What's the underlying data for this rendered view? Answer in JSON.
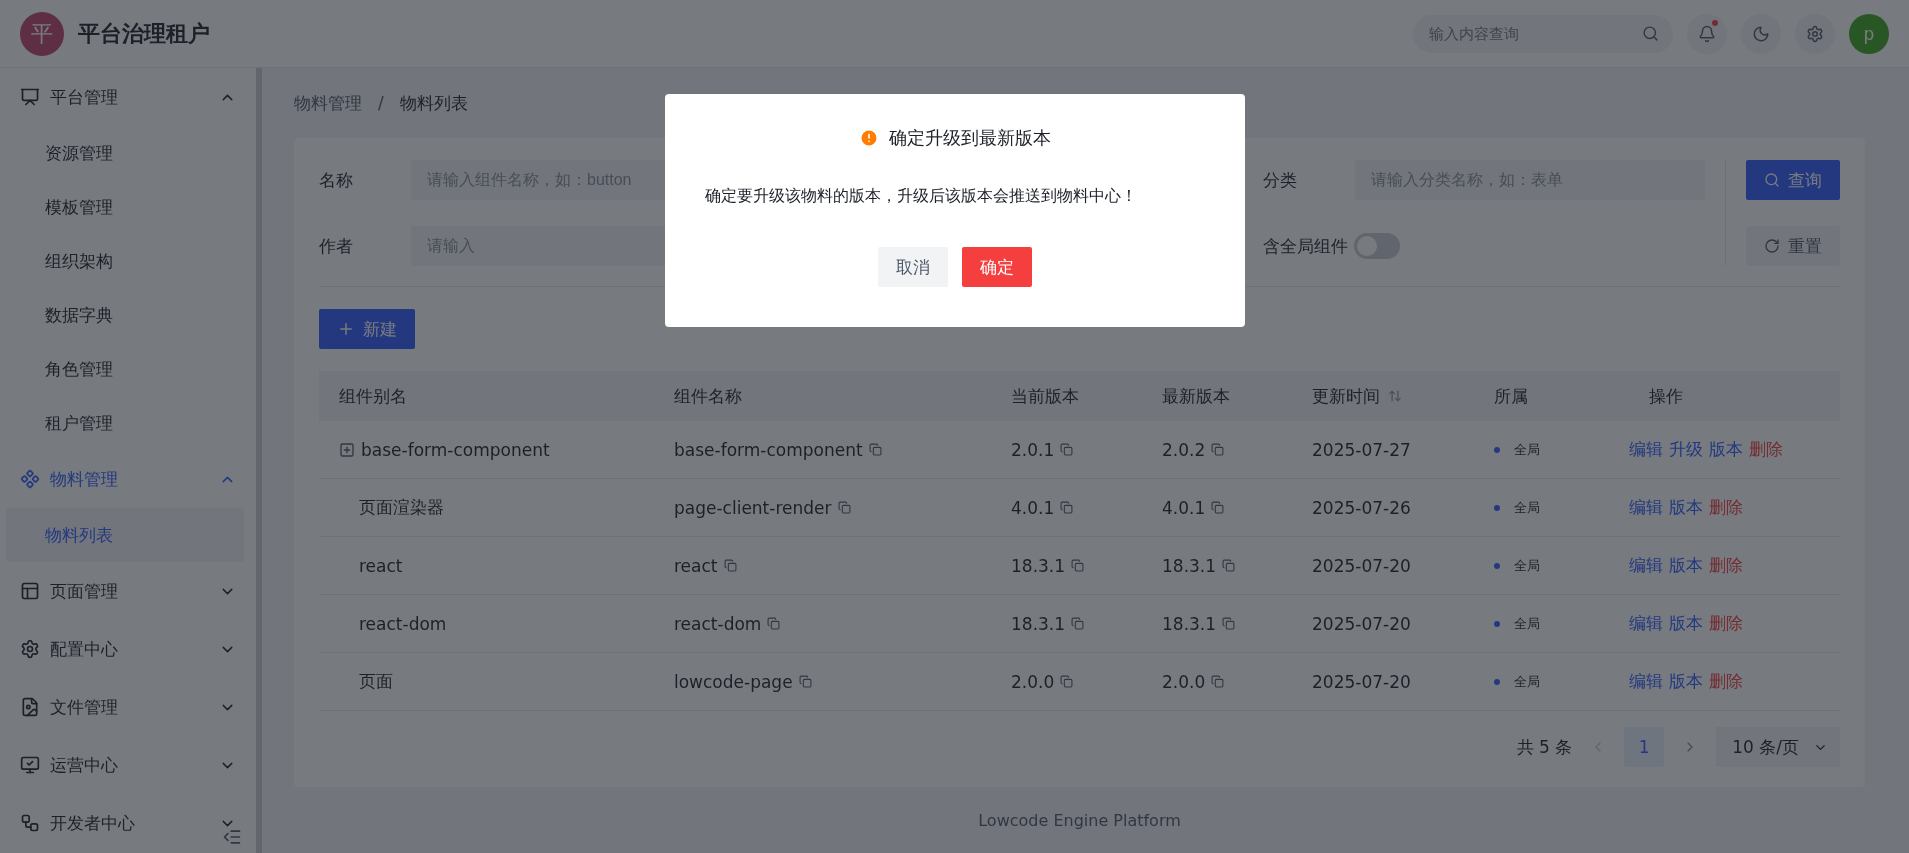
{
  "header": {
    "logo_letter": "平",
    "title": "平台治理租户",
    "search": {
      "placeholder": "输入内容查询"
    },
    "notification_dot": true,
    "avatar_letter": "p"
  },
  "sidebar": {
    "items": [
      {
        "label": "平台管理",
        "expanded": true,
        "selected": false,
        "children": [
          {
            "label": "资源管理",
            "selected": false
          },
          {
            "label": "模板管理",
            "selected": false
          },
          {
            "label": "组织架构",
            "selected": false
          },
          {
            "label": "数据字典",
            "selected": false
          },
          {
            "label": "角色管理",
            "selected": false
          },
          {
            "label": "租户管理",
            "selected": false
          }
        ]
      },
      {
        "label": "物料管理",
        "expanded": true,
        "selected": true,
        "children": [
          {
            "label": "物料列表",
            "selected": true
          }
        ]
      },
      {
        "label": "页面管理",
        "expanded": false,
        "selected": false
      },
      {
        "label": "配置中心",
        "expanded": false,
        "selected": false
      },
      {
        "label": "文件管理",
        "expanded": false,
        "selected": false
      },
      {
        "label": "运营中心",
        "expanded": false,
        "selected": false
      },
      {
        "label": "开发者中心",
        "expanded": false,
        "selected": false
      }
    ]
  },
  "breadcrumb": {
    "items": [
      "物料管理",
      "物料列表"
    ],
    "separator": "/"
  },
  "filters": {
    "fields": [
      {
        "label": "名称",
        "placeholder": "请输入组件名称，如：button"
      },
      {
        "label": "分类",
        "placeholder": "请输入分类名称，如：表单"
      },
      {
        "label": "作者",
        "placeholder": "请输入"
      }
    ],
    "switch": {
      "label": "含全局组件",
      "on": false
    },
    "buttons": [
      {
        "label": "查询",
        "kind": "primary"
      },
      {
        "label": "重置",
        "kind": "secondary"
      }
    ]
  },
  "new_button": {
    "label": "新建"
  },
  "table": {
    "columns": [
      {
        "label": "组件别名",
        "sortable": false
      },
      {
        "label": "组件名称",
        "sortable": false
      },
      {
        "label": "当前版本",
        "sortable": false
      },
      {
        "label": "最新版本",
        "sortable": false
      },
      {
        "label": "更新时间",
        "sortable": true
      },
      {
        "label": "所属",
        "sortable": false
      },
      {
        "label": "操作",
        "sortable": false
      }
    ],
    "rows": [
      {
        "alias": "base-form-component",
        "expandable": true,
        "name": "base-form-component",
        "current": "2.0.1",
        "latest": "2.0.2",
        "updated": "2025-07-27",
        "scope": "全局",
        "actions": [
          {
            "label": "编辑",
            "kind": "link"
          },
          {
            "label": "升级",
            "kind": "link"
          },
          {
            "label": "版本",
            "kind": "link"
          },
          {
            "label": "删除",
            "kind": "danger"
          }
        ]
      },
      {
        "alias": "页面渲染器",
        "expandable": false,
        "name": "page-client-render",
        "current": "4.0.1",
        "latest": "4.0.1",
        "updated": "2025-07-26",
        "scope": "全局",
        "actions": [
          {
            "label": "编辑",
            "kind": "link"
          },
          {
            "label": "版本",
            "kind": "link"
          },
          {
            "label": "删除",
            "kind": "danger"
          }
        ]
      },
      {
        "alias": "react",
        "expandable": false,
        "name": "react",
        "current": "18.3.1",
        "latest": "18.3.1",
        "updated": "2025-07-20",
        "scope": "全局",
        "actions": [
          {
            "label": "编辑",
            "kind": "link"
          },
          {
            "label": "版本",
            "kind": "link"
          },
          {
            "label": "删除",
            "kind": "danger"
          }
        ]
      },
      {
        "alias": "react-dom",
        "expandable": false,
        "name": "react-dom",
        "current": "18.3.1",
        "latest": "18.3.1",
        "updated": "2025-07-20",
        "scope": "全局",
        "actions": [
          {
            "label": "编辑",
            "kind": "link"
          },
          {
            "label": "版本",
            "kind": "link"
          },
          {
            "label": "删除",
            "kind": "danger"
          }
        ]
      },
      {
        "alias": "页面",
        "expandable": false,
        "name": "lowcode-page",
        "current": "2.0.0",
        "latest": "2.0.0",
        "updated": "2025-07-20",
        "scope": "全局",
        "actions": [
          {
            "label": "编辑",
            "kind": "link"
          },
          {
            "label": "版本",
            "kind": "link"
          },
          {
            "label": "删除",
            "kind": "danger"
          }
        ]
      }
    ]
  },
  "pagination": {
    "total": "共 5 条",
    "pages": [
      {
        "label": "1",
        "selected": true
      }
    ],
    "page_size": "10 条/页"
  },
  "footer": "Lowcode Engine Platform",
  "modal": {
    "title": "确定升级到最新版本",
    "message": "确定要升级该物料的版本，升级后该版本会推送到物料中心！",
    "buttons": [
      {
        "label": "取消",
        "kind": "secondary"
      },
      {
        "label": "确定",
        "kind": "danger"
      }
    ]
  }
}
